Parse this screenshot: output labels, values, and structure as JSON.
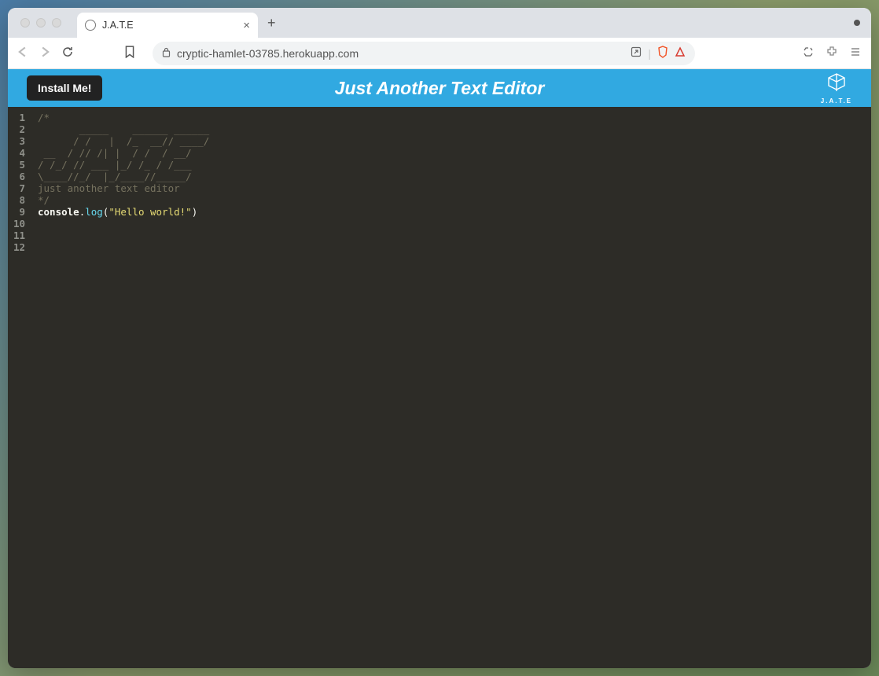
{
  "browser": {
    "tab": {
      "title": "J.A.T.E"
    },
    "url": "cryptic-hamlet-03785.herokuapp.com"
  },
  "header": {
    "install_label": "Install Me!",
    "app_title": "Just Another Text Editor",
    "logo_label": "J.A.T.E"
  },
  "editor": {
    "line_numbers": [
      "1",
      "2",
      "3",
      "4",
      "5",
      "6",
      "7",
      "8",
      "9",
      "10",
      "11",
      "12"
    ],
    "lines": {
      "l1": "",
      "l2": "/*",
      "l3": "       _____    ______ ______",
      "l4": "      / /   |  /_  __// ____/",
      "l5": " __  / // /| |  / /  / __/",
      "l6": "/ /_/ // ___ |_/ /_ / /___",
      "l7": "\\____//_/  |_/____//_____/",
      "l8": "just another text editor",
      "l9": "*/",
      "l10": "",
      "l11": ""
    },
    "line12": {
      "obj": "console",
      "dot": ".",
      "method": "log",
      "open": "(",
      "string": "\"Hello world!\"",
      "close": ")"
    }
  }
}
